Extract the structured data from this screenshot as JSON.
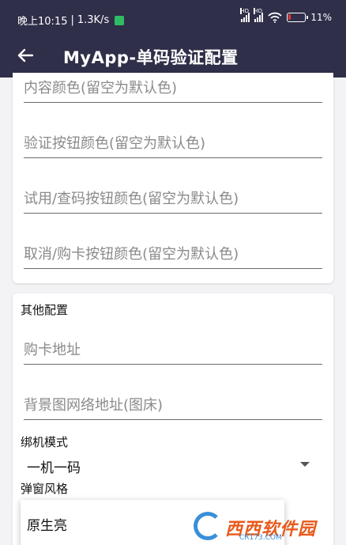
{
  "status_bar": {
    "time": "晚上10:15",
    "separator": "|",
    "speed": "1.3K/s",
    "sim1": "HD",
    "sim2": "HD",
    "battery": "11%"
  },
  "toolbar": {
    "title": "MyApp-单码验证配置"
  },
  "color_fields": [
    {
      "placeholder": "内容颜色(留空为默认色)"
    },
    {
      "placeholder": "验证按钮颜色(留空为默认色)"
    },
    {
      "placeholder": "试用/查码按钮颜色(留空为默认色)"
    },
    {
      "placeholder": "取消/购卡按钮颜色(留空为默认色)"
    }
  ],
  "other_config": {
    "title": "其他配置",
    "buy_card_url_placeholder": "购卡地址",
    "bg_image_url_placeholder": "背景图网络地址(图床)",
    "bind_mode_label": "绑机模式",
    "bind_mode_value": "一机一码",
    "dialog_style_label": "弹窗风格",
    "dialog_style_option": "原生亮"
  },
  "watermark": {
    "brand": "西西软件园",
    "url": "CR173.COM"
  },
  "colors": {
    "appbar": "#2f2f49",
    "background": "#f3f3f5",
    "battery_low": "#e53935"
  }
}
